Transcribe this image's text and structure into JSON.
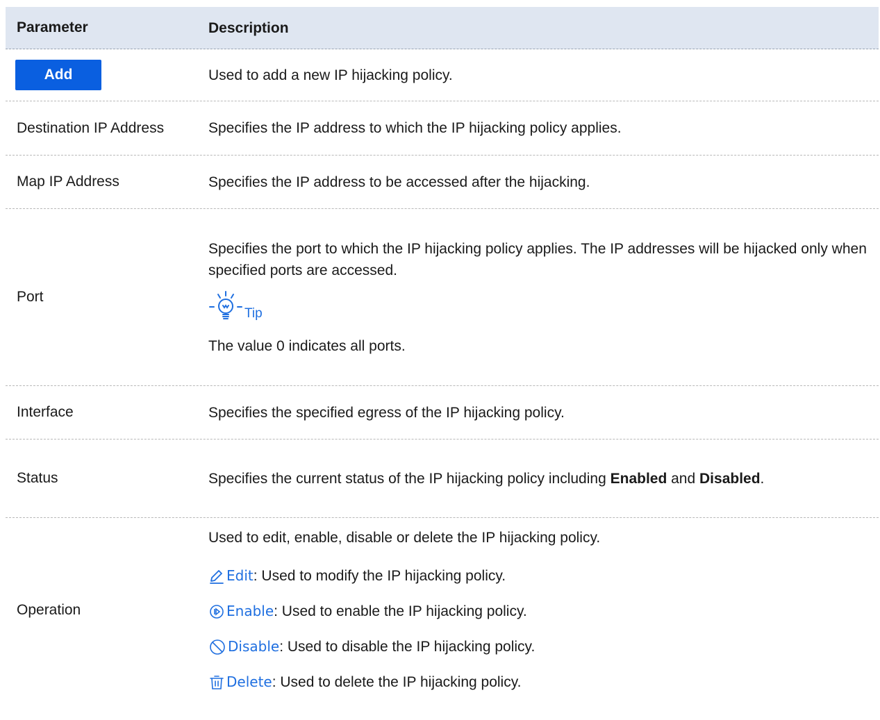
{
  "header": {
    "parameter": "Parameter",
    "description": "Description"
  },
  "rows": {
    "add": {
      "button_label": "Add",
      "description": "Used to add a new IP hijacking policy."
    },
    "destination": {
      "parameter": "Destination IP Address",
      "description": "Specifies the IP address to which the IP hijacking policy applies."
    },
    "map": {
      "parameter": "Map IP Address",
      "description": "Specifies the IP address to be accessed after the hijacking."
    },
    "port": {
      "parameter": "Port",
      "description": "Specifies the port to which the IP hijacking policy applies. The IP addresses will be hijacked only when specified ports are accessed.",
      "tip_label": "Tip",
      "tip_text": "The value 0 indicates all ports."
    },
    "interface": {
      "parameter": "Interface",
      "description": "Specifies the specified egress of the IP hijacking policy."
    },
    "status": {
      "parameter": "Status",
      "description_prefix": "Specifies the current status of the IP hijacking policy including ",
      "enabled": "Enabled",
      "and": " and ",
      "disabled": "Disabled",
      "period": "."
    },
    "operation": {
      "parameter": "Operation",
      "description": "Used to edit, enable, disable or delete the IP hijacking policy.",
      "items": [
        {
          "icon": "edit-icon",
          "label": "Edit",
          "text": ": Used to modify the IP hijacking policy."
        },
        {
          "icon": "enable-icon",
          "label": "Enable",
          "text": ": Used to enable the IP hijacking policy."
        },
        {
          "icon": "disable-icon",
          "label": "Disable",
          "text": ": Used to disable the IP hijacking policy."
        },
        {
          "icon": "delete-icon",
          "label": "Delete",
          "text": ": Used to delete the IP hijacking policy."
        }
      ]
    }
  },
  "colors": {
    "header_bg": "#dfe6f1",
    "accent_blue": "#1f6fe0",
    "button_blue": "#0a5fe0"
  }
}
